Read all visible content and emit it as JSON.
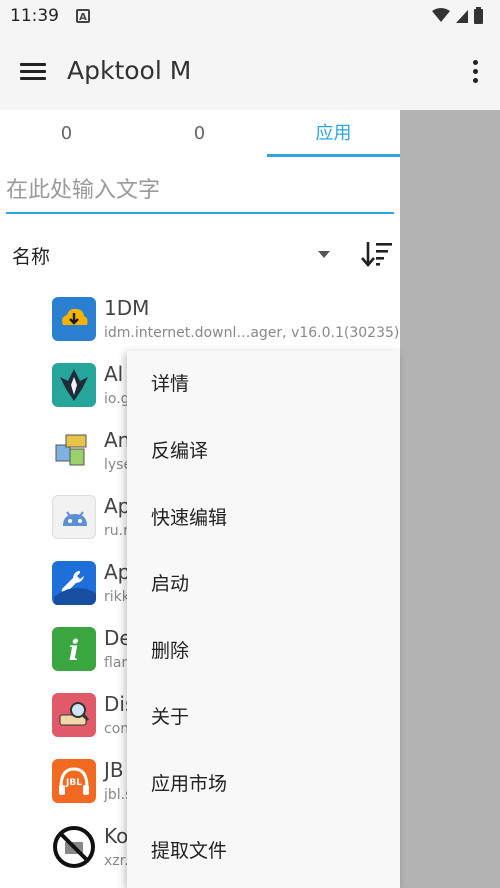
{
  "status_bar": {
    "time": "11:39",
    "notification_icon": "A"
  },
  "app_bar": {
    "title": "Apktool M"
  },
  "tabs": [
    {
      "label": "0"
    },
    {
      "label": "0"
    },
    {
      "label": "应用"
    }
  ],
  "search": {
    "placeholder": "在此处输入文字"
  },
  "sort": {
    "label": "名称"
  },
  "apps": [
    {
      "name": "1DM",
      "package": "idm.internet.downl…ager, v16.0.1(30235)",
      "icon": "cloud-download-icon",
      "color": "#2a7fd0"
    },
    {
      "name": "Al",
      "package": "io.g",
      "icon": "magisk-icon",
      "color": "#26a69a"
    },
    {
      "name": "An",
      "package": "lyse",
      "icon": "package-tools-icon",
      "color": "#d0d0d0"
    },
    {
      "name": "Ap",
      "package": "ru.r",
      "icon": "android-icon",
      "color": "#f2f2f2"
    },
    {
      "name": "Ap",
      "package": "rikk",
      "icon": "wrench-icon",
      "color": "#1e6fd9"
    },
    {
      "name": "De",
      "package": "flar",
      "icon": "info-icon",
      "color": "#3aa640"
    },
    {
      "name": "Dis",
      "package": "con",
      "icon": "disk-icon",
      "color": "#e05a6a"
    },
    {
      "name": "JB",
      "package": "jbl.s",
      "icon": "jbl-headphones-icon",
      "color": "#f26a21"
    },
    {
      "name": "Ko",
      "package": "xzr.",
      "icon": "no-entry-icon",
      "color": "#ffffff"
    }
  ],
  "context_menu": {
    "items": [
      "详情",
      "反编译",
      "快速编辑",
      "启动",
      "删除",
      "关于",
      "应用市场",
      "提取文件"
    ]
  }
}
